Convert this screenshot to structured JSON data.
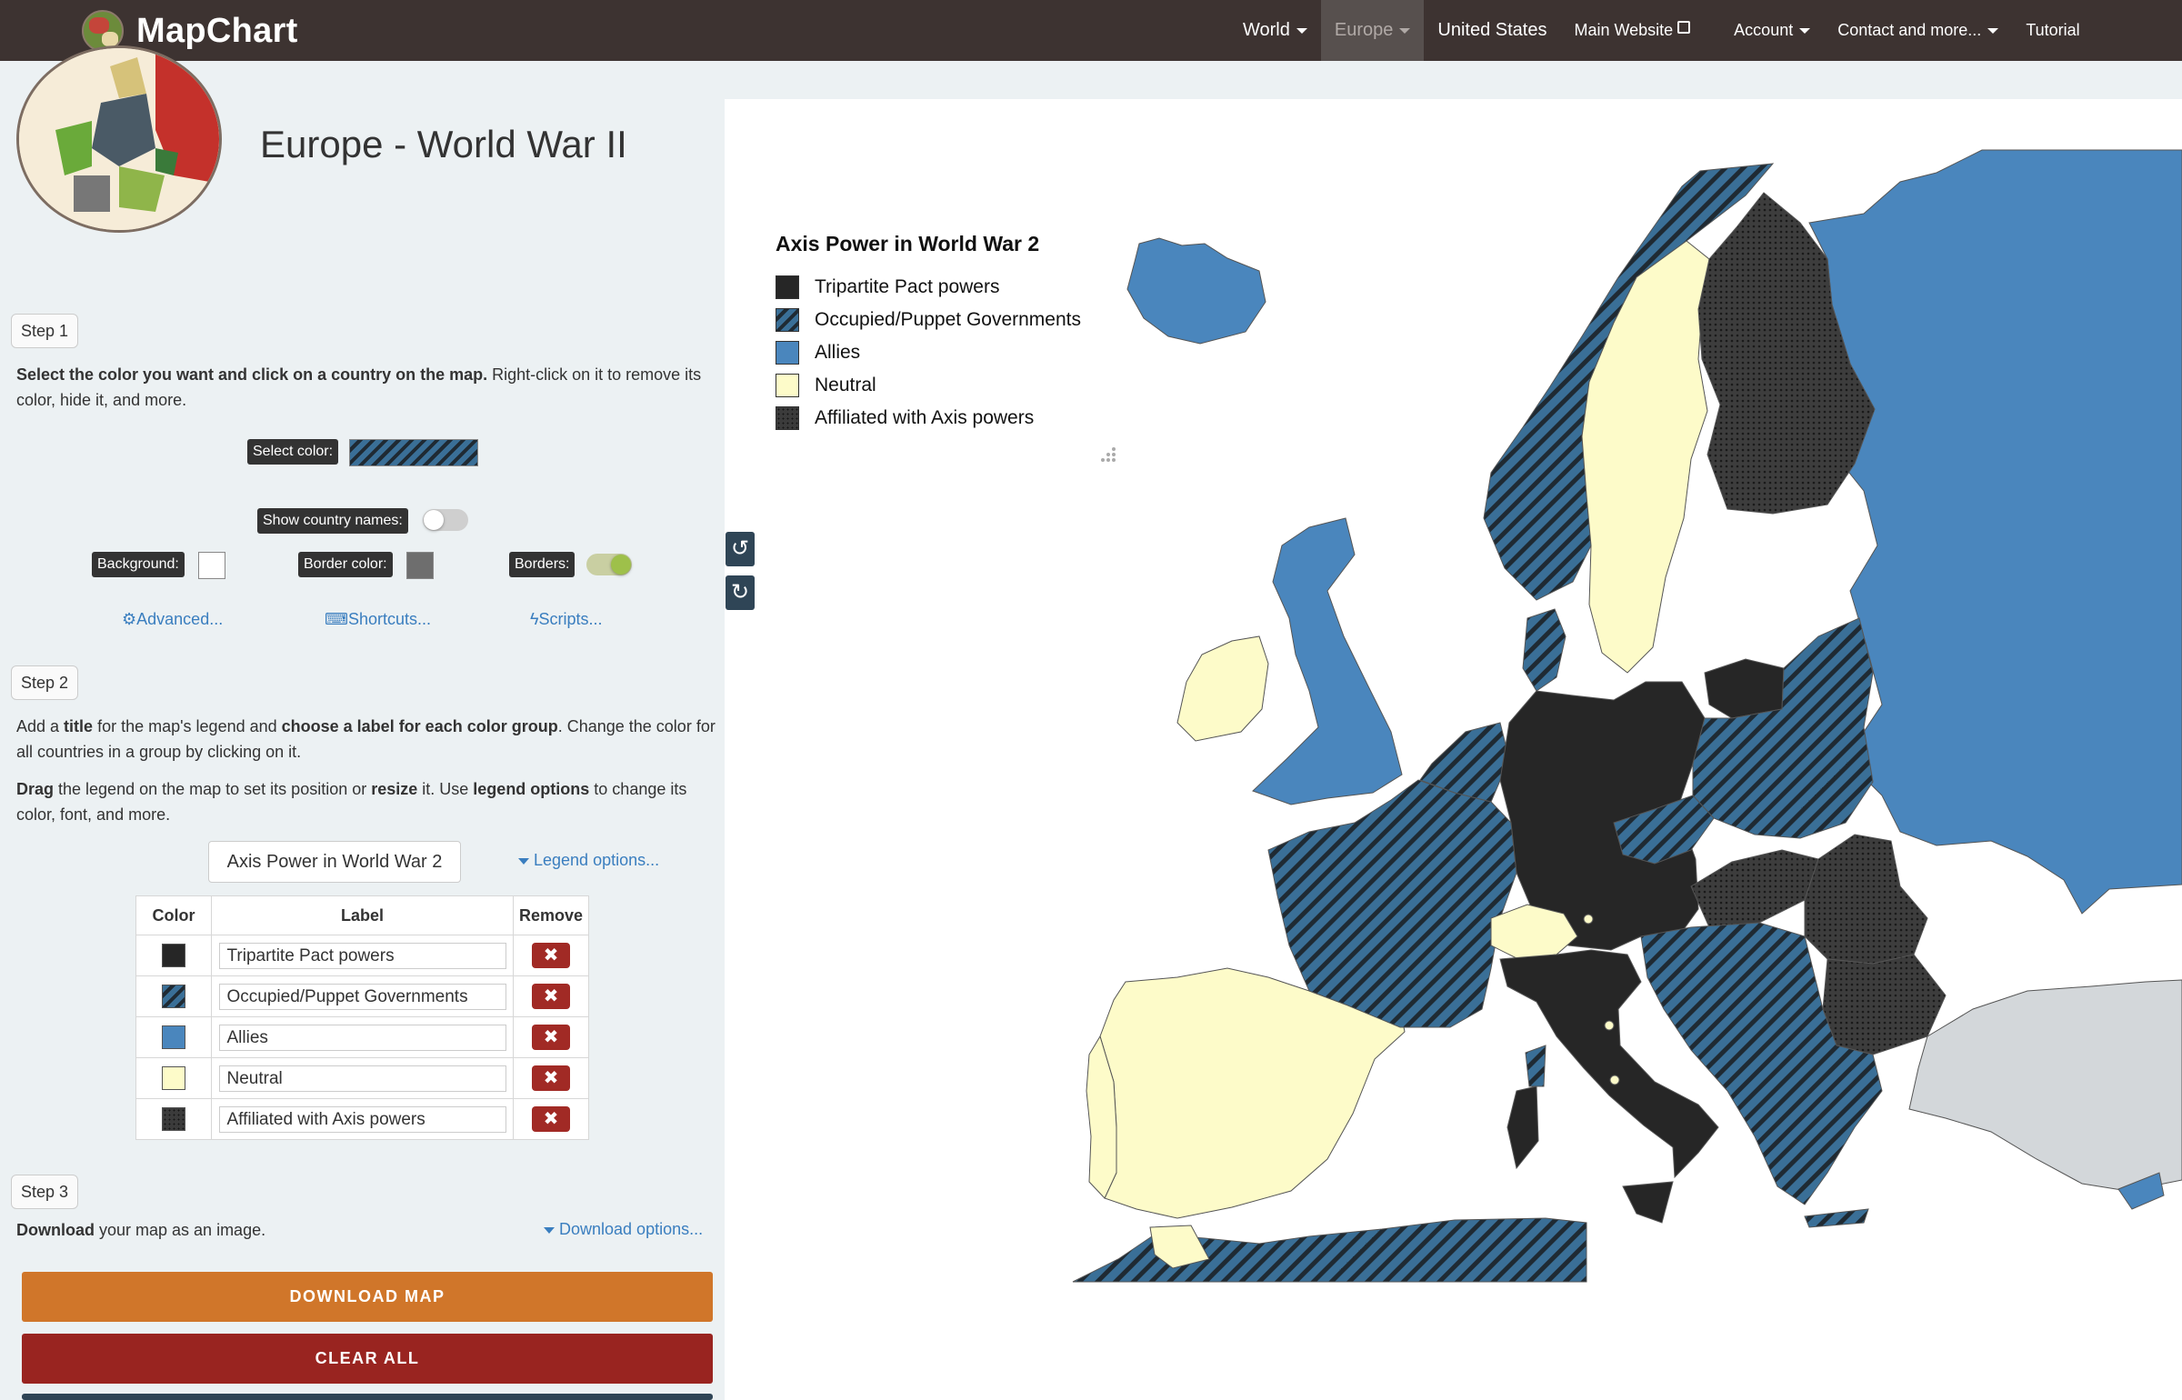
{
  "navbar": {
    "brand": "MapChart",
    "items": [
      {
        "label": "World",
        "dropdown": true
      },
      {
        "label": "Europe",
        "dropdown": true,
        "active": true
      },
      {
        "label": "United States",
        "dropdown": false
      },
      {
        "label": "Main Website",
        "external": true
      },
      {
        "label": "Account",
        "dropdown": true
      },
      {
        "label": "Contact and more...",
        "dropdown": true
      },
      {
        "label": "Tutorial",
        "dropdown": false
      }
    ]
  },
  "page": {
    "title": "Europe - World War II"
  },
  "step1": {
    "badge": "Step 1",
    "instruction_bold": "Select the color you want and click on a country on the map.",
    "instruction_rest": " Right-click on it to remove its color, hide it, and more.",
    "select_color_label": "Select color:",
    "show_names_label": "Show country names:",
    "show_names_on": false,
    "background_label": "Background:",
    "border_color_label": "Border color:",
    "borders_label": "Borders:",
    "borders_on": true,
    "links": [
      "Advanced...",
      "Shortcuts...",
      "Scripts..."
    ]
  },
  "step2": {
    "badge": "Step 2",
    "p1": [
      "Add a ",
      "title",
      " for the map's legend and ",
      "choose a label for each color group",
      ". Change the color for all countries in a group by clicking on it."
    ],
    "p2": [
      "Drag",
      " the legend on the map to set its position or ",
      "resize",
      " it. Use ",
      "legend options",
      " to change its color, font, and more."
    ],
    "legend_title_value": "Axis Power in World War 2",
    "legend_options_link": "Legend options...",
    "table_headers": [
      "Color",
      "Label",
      "Remove"
    ],
    "remove_symbol": "✖"
  },
  "groups": [
    {
      "label": "Tripartite Pact powers",
      "color": "#262626",
      "pattern": "solid"
    },
    {
      "label": "Occupied/Puppet Governments",
      "color": "#3a6f97",
      "pattern": "hatch"
    },
    {
      "label": "Allies",
      "color": "#4a86bd",
      "pattern": "solid"
    },
    {
      "label": "Neutral",
      "color": "#fdfbc9",
      "pattern": "solid"
    },
    {
      "label": "Affiliated with Axis powers",
      "color": "#3b3b3b",
      "pattern": "dots"
    }
  ],
  "step3": {
    "badge": "Step 3",
    "download_bold": "Download",
    "download_rest": " your map as an image.",
    "download_options_link": "Download options...",
    "download_button": "DOWNLOAD MAP",
    "clear_button": "CLEAR ALL"
  },
  "map": {
    "legend_title": "Axis Power in World War 2",
    "undo_icon": "undo-icon",
    "redo_icon": "redo-icon"
  },
  "colors": {
    "navbar": "#3d3331",
    "download": "#d0762a",
    "clear": "#992420",
    "remove": "#a12a25",
    "link": "#3a7ebf",
    "borders_toggle": "#9ec04a"
  }
}
